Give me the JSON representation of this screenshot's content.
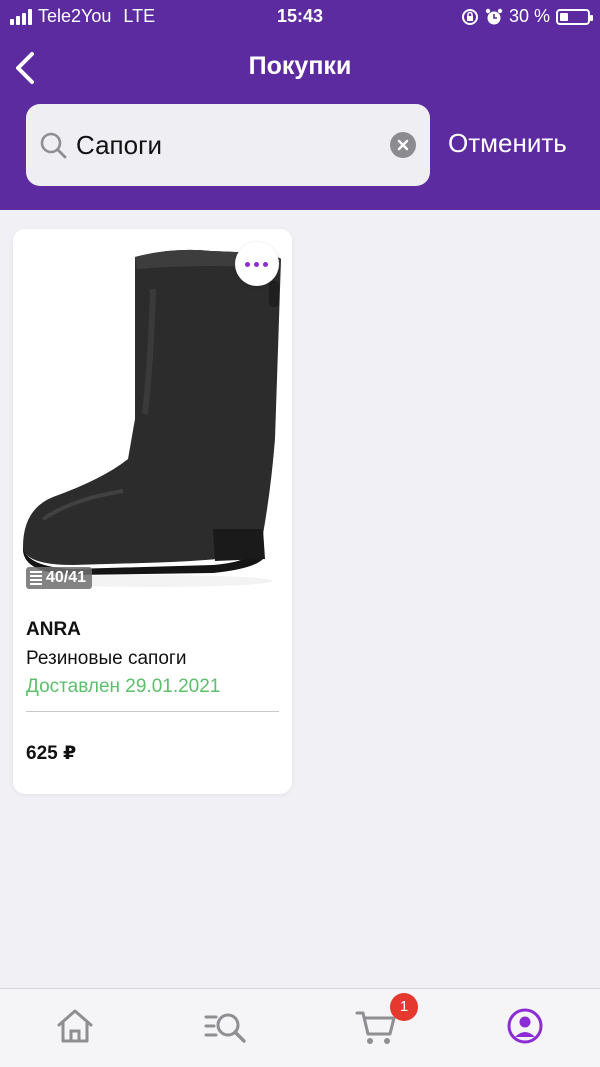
{
  "status_bar": {
    "carrier": "Tele2You",
    "network": "LTE",
    "time": "15:43",
    "battery_text": "30 %",
    "battery_level": 0.3
  },
  "header": {
    "title": "Покупки",
    "back_icon": "chevron-left-icon"
  },
  "search": {
    "value": "Сапоги",
    "cancel_label": "Отменить",
    "icons": [
      "search-icon",
      "clear-icon"
    ]
  },
  "products": [
    {
      "brand": "ANRA",
      "name": "Резиновые сапоги",
      "status": "Доставлен 29.01.2021",
      "price": "625 ₽",
      "photo_badge": "40/41",
      "image": "black-rubber-boot"
    }
  ],
  "tab_bar": {
    "items": [
      "home-icon",
      "catalog-search-icon",
      "cart-icon",
      "profile-icon"
    ],
    "active": "profile-icon",
    "cart_count": "1"
  },
  "colors": {
    "header": "#5c2ba0",
    "accent": "#8b2cd4",
    "status_green": "#5cbf6a",
    "badge_red": "#e5392f"
  }
}
